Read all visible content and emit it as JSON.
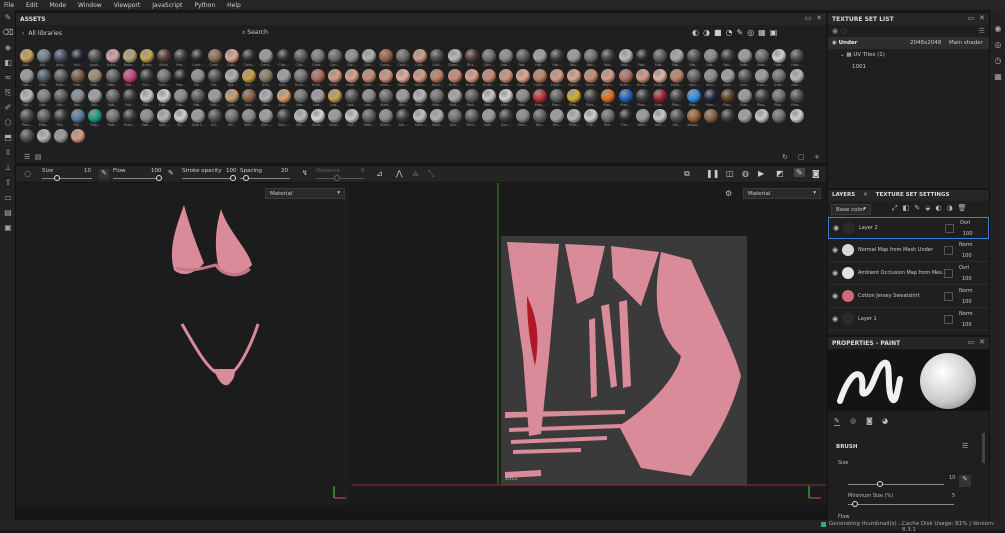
{
  "menu": [
    "File",
    "Edit",
    "Mode",
    "Window",
    "Viewport",
    "JavaScript",
    "Python",
    "Help"
  ],
  "assets": {
    "title": "ASSETS",
    "library": "All libraries",
    "search_placeholder": "Search",
    "materials": [
      {
        "label": "Alu...",
        "color": "#c9a15a"
      },
      {
        "label": "Alu...",
        "color": "#6e7b87"
      },
      {
        "label": "And...",
        "color": "#3f4f62"
      },
      {
        "label": "Arti...",
        "color": "#1e2530"
      },
      {
        "label": "Asph...",
        "color": "#4e4e4e"
      },
      {
        "label": "Auto...",
        "color": "#d8a0a8"
      },
      {
        "label": "Bake...",
        "color": "#b9a47a"
      },
      {
        "label": "Brass",
        "color": "#c8a64d"
      },
      {
        "label": "Brick",
        "color": "#5a3a30"
      },
      {
        "label": "Bro...",
        "color": "#3b3b3b"
      },
      {
        "label": "Carb...",
        "color": "#2a2a2a"
      },
      {
        "label": "Card...",
        "color": "#8a6e50"
      },
      {
        "label": "Carl...",
        "color": "#e0a892"
      },
      {
        "label": "Carb...",
        "color": "#303030"
      },
      {
        "label": "Cera...",
        "color": "#9a9a9a"
      },
      {
        "label": "Clot...",
        "color": "#2d2d2d"
      },
      {
        "label": "Clot...",
        "color": "#585858"
      },
      {
        "label": "Coat...",
        "color": "#7a7a7a"
      },
      {
        "label": "Con...",
        "color": "#6a6a6a"
      },
      {
        "label": "Con...",
        "color": "#8f8f8f"
      },
      {
        "label": "Con...",
        "color": "#b0b0b0"
      },
      {
        "label": "Copp...",
        "color": "#9a6040"
      },
      {
        "label": "Cord...",
        "color": "#6b6b6b"
      },
      {
        "label": "Cott...",
        "color": "#d59a84"
      },
      {
        "label": "Cott...",
        "color": "#4a4a4a"
      },
      {
        "label": "Diam...",
        "color": "#b8b8b8"
      },
      {
        "label": "Dirt...",
        "color": "#4a3a30"
      },
      {
        "label": "Dirt...",
        "color": "#707070"
      },
      {
        "label": "Fab...",
        "color": "#8b8b8b"
      },
      {
        "label": "Fab...",
        "color": "#5a5a5a"
      },
      {
        "label": "Fab...",
        "color": "#a0a0a0"
      },
      {
        "label": "Fab...",
        "color": "#3a3a3a"
      },
      {
        "label": "Fab...",
        "color": "#9a9a9a"
      },
      {
        "label": "Fab...",
        "color": "#707070"
      },
      {
        "label": "Fab...",
        "color": "#404040"
      },
      {
        "label": "Fab...",
        "color": "#b8b8b8"
      },
      {
        "label": "Fab...",
        "color": "#2a2a2a"
      },
      {
        "label": "Fab...",
        "color": "#606060"
      },
      {
        "label": "Fab...",
        "color": "#a8a8a8"
      },
      {
        "label": "Fab...",
        "color": "#505050"
      },
      {
        "label": "Fab...",
        "color": "#888888"
      },
      {
        "label": "Fab...",
        "color": "#3a3a3a"
      },
      {
        "label": "Fabr...",
        "color": "#9a9a9a"
      },
      {
        "label": "Fabr...",
        "color": "#6a6a6a"
      },
      {
        "label": "Fabr...",
        "color": "#d0d0d0"
      },
      {
        "label": "Fabr...",
        "color": "#4a4a4a"
      },
      {
        "label": "Fab...",
        "color": "#9a9a9a"
      },
      {
        "label": "Fab...",
        "color": "#4a5a6a"
      },
      {
        "label": "Fabr...",
        "color": "#5a5a5a"
      },
      {
        "label": "Fabr...",
        "color": "#7a5a40"
      },
      {
        "label": "Fabr...",
        "color": "#9a8a70"
      },
      {
        "label": "Fabr...",
        "color": "#606060"
      },
      {
        "label": "Fab...",
        "color": "#d04080"
      },
      {
        "label": "Fla...",
        "color": "#3a3a3a"
      },
      {
        "label": "Fabr...",
        "color": "#707070"
      },
      {
        "label": "Fab...",
        "color": "#2a2a2a"
      },
      {
        "label": "Fol...",
        "color": "#909090"
      },
      {
        "label": "Fur...",
        "color": "#505050"
      },
      {
        "label": "Gla...",
        "color": "#b0b0b0"
      },
      {
        "label": "Gol...",
        "color": "#c9a040"
      },
      {
        "label": "Gro...",
        "color": "#8a7a60"
      },
      {
        "label": "Gro...",
        "color": "#a0a0a0"
      },
      {
        "label": "Hum...",
        "color": "#707070"
      },
      {
        "label": "Hum...",
        "color": "#b06a5a"
      },
      {
        "label": "Hum...",
        "color": "#d89a80"
      },
      {
        "label": "Hum...",
        "color": "#e0a088"
      },
      {
        "label": "Hum...",
        "color": "#c88a70"
      },
      {
        "label": "Hum...",
        "color": "#d49480"
      },
      {
        "label": "Hum...",
        "color": "#e8b098"
      },
      {
        "label": "Hum...",
        "color": "#d89a84"
      },
      {
        "label": "Hum...",
        "color": "#c47a60"
      },
      {
        "label": "Hum...",
        "color": "#d08a74"
      },
      {
        "label": "Hum...",
        "color": "#e09e88"
      },
      {
        "label": "Hum...",
        "color": "#cc8870"
      },
      {
        "label": "Hum...",
        "color": "#d89680"
      },
      {
        "label": "Hum...",
        "color": "#e4a890"
      },
      {
        "label": "Hum...",
        "color": "#c48068"
      },
      {
        "label": "Hum...",
        "color": "#d89a84"
      },
      {
        "label": "Hum...",
        "color": "#e0a48c"
      },
      {
        "label": "Hum...",
        "color": "#cc8a72"
      },
      {
        "label": "Hum...",
        "color": "#d89a82"
      },
      {
        "label": "Hum...",
        "color": "#b07060"
      },
      {
        "label": "Hum...",
        "color": "#d49a86"
      },
      {
        "label": "Hum...",
        "color": "#e6b0a0"
      },
      {
        "label": "Hum...",
        "color": "#c0806a"
      },
      {
        "label": "Iron...",
        "color": "#606060"
      },
      {
        "label": "Iron...",
        "color": "#8a8a8a"
      },
      {
        "label": "Iron...",
        "color": "#a0a0a0"
      },
      {
        "label": "Iron...",
        "color": "#505050"
      },
      {
        "label": "Iron...",
        "color": "#9a9a9a"
      },
      {
        "label": "Iron...",
        "color": "#707070"
      },
      {
        "label": "Iron...",
        "color": "#b8b8b8"
      },
      {
        "label": "Fab...",
        "color": "#b8b8b8"
      },
      {
        "label": "Fab...",
        "color": "#7a7a7a"
      },
      {
        "label": "Fab...",
        "color": "#5a5a5a"
      },
      {
        "label": "Fab...",
        "color": "#8a8a8a"
      },
      {
        "label": "Fab...",
        "color": "#a0a0a0"
      },
      {
        "label": "Fab...",
        "color": "#606060"
      },
      {
        "label": "Fab...",
        "color": "#3a3a3a"
      },
      {
        "label": "Fla...",
        "color": "#c8c8c8"
      },
      {
        "label": "Fab...",
        "color": "#d0d0d0"
      },
      {
        "label": "Fab...",
        "color": "#888888"
      },
      {
        "label": "Fab...",
        "color": "#5a5a5a"
      },
      {
        "label": "Fab...",
        "color": "#9a9a9a"
      },
      {
        "label": "Lea...",
        "color": "#c8a070"
      },
      {
        "label": "Lea...",
        "color": "#8a6040"
      },
      {
        "label": "Lea...",
        "color": "#b0b0b0"
      },
      {
        "label": "Lea...",
        "color": "#d8a070"
      },
      {
        "label": "Lea...",
        "color": "#707070"
      },
      {
        "label": "Lea...",
        "color": "#a0a0a0"
      },
      {
        "label": "Lea...",
        "color": "#c8a050"
      },
      {
        "label": "Lea...",
        "color": "#505050"
      },
      {
        "label": "Lea...",
        "color": "#8a8a8a"
      },
      {
        "label": "Mart...",
        "color": "#6a6a6a"
      },
      {
        "label": "Mar...",
        "color": "#9a9a9a"
      },
      {
        "label": "Met...",
        "color": "#b8b8b8"
      },
      {
        "label": "Met...",
        "color": "#707070"
      },
      {
        "label": "Met...",
        "color": "#a8a8a8"
      },
      {
        "label": "Met...",
        "color": "#5a5a5a"
      },
      {
        "label": "Met...",
        "color": "#c8c8c8"
      },
      {
        "label": "Met...",
        "color": "#d0d0d0"
      },
      {
        "label": "Met...",
        "color": "#8a8a8a"
      },
      {
        "label": "Plas...",
        "color": "#c03030"
      },
      {
        "label": "Plas...",
        "color": "#606060"
      },
      {
        "label": "Plas...",
        "color": "#d0b030"
      },
      {
        "label": "Plas...",
        "color": "#404040"
      },
      {
        "label": "Plas...",
        "color": "#e07020"
      },
      {
        "label": "Plas...",
        "color": "#2060c0"
      },
      {
        "label": "Plas...",
        "color": "#3a3a3a"
      },
      {
        "label": "Plas...",
        "color": "#a02030"
      },
      {
        "label": "Plas...",
        "color": "#404040"
      },
      {
        "label": "Plas...",
        "color": "#3090e0"
      },
      {
        "label": "Plas...",
        "color": "#202a40"
      },
      {
        "label": "Plas...",
        "color": "#604020"
      },
      {
        "label": "Plas...",
        "color": "#9a9a9a"
      },
      {
        "label": "Plas...",
        "color": "#404040"
      },
      {
        "label": "Plas...",
        "color": "#707070"
      },
      {
        "label": "Plas...",
        "color": "#505050"
      },
      {
        "label": "Plas...",
        "color": "#4a4a4a"
      },
      {
        "label": "Plas...",
        "color": "#5a5a5a"
      },
      {
        "label": "Pla...",
        "color": "#3a3a3a"
      },
      {
        "label": "Pol...",
        "color": "#5a7aa0"
      },
      {
        "label": "Rub...",
        "color": "#1a9a80"
      },
      {
        "label": "Rub...",
        "color": "#707070"
      },
      {
        "label": "Rust...",
        "color": "#3a3a3a"
      },
      {
        "label": "Sati...",
        "color": "#8a8a8a"
      },
      {
        "label": "Sea...",
        "color": "#b0b0b0"
      },
      {
        "label": "Sil...",
        "color": "#d0d0d0"
      },
      {
        "label": "Scarf...",
        "color": "#9a9a9a"
      },
      {
        "label": "Sci...",
        "color": "#505050"
      },
      {
        "label": "Shi...",
        "color": "#707070"
      },
      {
        "label": "Skin...",
        "color": "#8a8a8a"
      },
      {
        "label": "Skin...",
        "color": "#a0a0a0"
      },
      {
        "label": "Skin...",
        "color": "#3a3a3a"
      },
      {
        "label": "Slik...",
        "color": "#b8b8b8"
      },
      {
        "label": "Stee...",
        "color": "#d8d8d8"
      },
      {
        "label": "Smo...",
        "color": "#9a9a9a"
      },
      {
        "label": "Sof...",
        "color": "#c8c8c8"
      },
      {
        "label": "Stee...",
        "color": "#606060"
      },
      {
        "label": "Steel...",
        "color": "#8a8a8a"
      },
      {
        "label": "Ste...",
        "color": "#3a3a3a"
      },
      {
        "label": "Stee...",
        "color": "#c0c0c0"
      },
      {
        "label": "Stee...",
        "color": "#b0b0b0"
      },
      {
        "label": "Sto...",
        "color": "#707070"
      },
      {
        "label": "Stro...",
        "color": "#5a5a5a"
      },
      {
        "label": "Sud...",
        "color": "#9a9a9a"
      },
      {
        "label": "Sun...",
        "color": "#404040"
      },
      {
        "label": "Stro...",
        "color": "#8a8a8a"
      },
      {
        "label": "Tex...",
        "color": "#606060"
      },
      {
        "label": "Tex...",
        "color": "#a0a0a0"
      },
      {
        "label": "Tiles...",
        "color": "#b8b8b8"
      },
      {
        "label": "Tile...",
        "color": "#d0d0d0"
      },
      {
        "label": "Tex...",
        "color": "#707070"
      },
      {
        "label": "Tire...",
        "color": "#2a2a2a"
      },
      {
        "label": "Wall...",
        "color": "#9a9a9a"
      },
      {
        "label": "Veh...",
        "color": "#c8c8c8"
      },
      {
        "label": "Vel...",
        "color": "#505050"
      },
      {
        "label": "Wood...",
        "color": "#a06030"
      },
      {
        "label": "",
        "color": "#8a6040"
      },
      {
        "label": "",
        "color": "#3a3a3a"
      },
      {
        "label": "",
        "color": "#a0a0a0"
      },
      {
        "label": "",
        "color": "#c8c8c8"
      },
      {
        "label": "",
        "color": "#707070"
      },
      {
        "label": "",
        "color": "#d0d0d0"
      },
      {
        "label": "",
        "color": "#505050"
      },
      {
        "label": "",
        "color": "#b8b8b8"
      },
      {
        "label": "",
        "color": "#9a9a9a"
      },
      {
        "label": "",
        "color": "#d89a84"
      }
    ]
  },
  "toolbar": {
    "size_label": "Size",
    "size_value": "10",
    "flow_label": "Flow",
    "flow_value": "100",
    "stroke_label": "Stroke opacity",
    "stroke_value": "100",
    "spacing_label": "Spacing",
    "spacing_value": "20",
    "distance_label": "Distance",
    "distance_value": "8"
  },
  "viewports": {
    "left_select": "Material",
    "right_select": "Material",
    "uv_tile_label": "1001"
  },
  "texture_set_list": {
    "title": "TEXTURE SET LIST",
    "set_name": "Under",
    "resolution": "2048x2048",
    "shader": "Main shader",
    "uv_tiles": "UV Tiles (1)",
    "tile": "1001"
  },
  "layers": {
    "tab_layers": "LAYERS",
    "tab_settings": "TEXTURE SET SETTINGS",
    "channel": "Base color",
    "items": [
      {
        "name": "Layer 2",
        "blend": "Ovrl",
        "opacity": "100",
        "thumb": "#2a2a2a"
      },
      {
        "name": "Normal Map from Mesh Under",
        "blend": "Norm",
        "opacity": "100",
        "thumb": "#d8d8d8"
      },
      {
        "name": "Ambient Occlusion Map from Mes...",
        "blend": "Ovrl",
        "opacity": "100",
        "thumb": "#e0e0e0"
      },
      {
        "name": "Cotton Jersey Sweatshirt",
        "blend": "Norm",
        "opacity": "100",
        "thumb": "#d46a78"
      },
      {
        "name": "Layer 1",
        "blend": "Norm",
        "opacity": "100",
        "thumb": "#2a2a2a"
      }
    ]
  },
  "properties": {
    "title": "PROPERTIES - PAINT",
    "brush_label": "BRUSH",
    "size_label": "Size",
    "size_value": "10",
    "min_size_label": "Minimum Size (%)",
    "min_size_value": "5",
    "flow_label": "Flow"
  },
  "status": {
    "message": "Generating thumbnail(s) ...",
    "cache": "Cache Disk Usage:  81% | Version: 8.3.1"
  }
}
